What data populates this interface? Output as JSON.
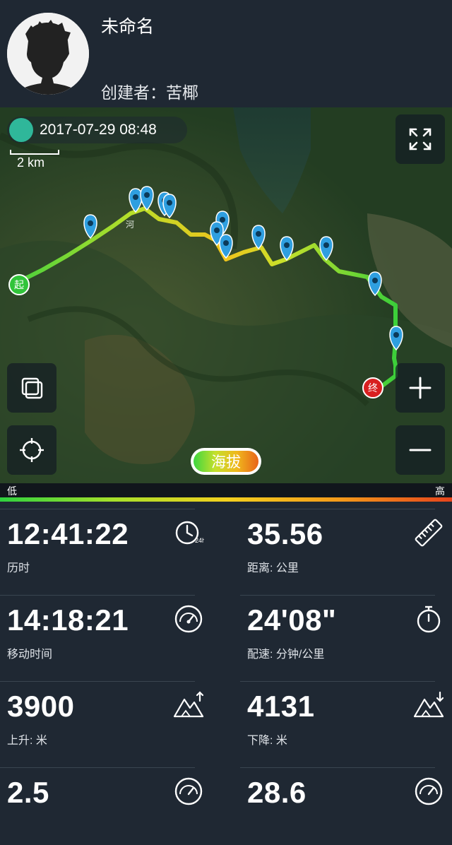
{
  "header": {
    "title": "未命名",
    "creator": "创建者：苦椰"
  },
  "map": {
    "date": "2017-07-29 08:48",
    "scale_label": "2 km",
    "start_marker": "起",
    "end_marker": "终",
    "place_label": "河",
    "legend_label": "海拔",
    "gradient_low": "低",
    "gradient_high": "高",
    "buttons": [
      "fullscreen-icon",
      "layers-icon",
      "locate-icon",
      "zoom-in-icon",
      "zoom-out-icon"
    ]
  },
  "stats": [
    {
      "value": "12:41:22",
      "label": "历时",
      "icon": "clock-24h-icon"
    },
    {
      "value": "35.56",
      "label": "距离: 公里",
      "icon": "ruler-icon"
    },
    {
      "value": "14:18:21",
      "label": "移动时间",
      "icon": "speedometer-icon"
    },
    {
      "value": "24'08\"",
      "label": "配速: 分钟/公里",
      "icon": "stopwatch-icon"
    },
    {
      "value": "3900",
      "label": "上升: 米",
      "icon": "mountain-up-icon"
    },
    {
      "value": "4131",
      "label": "下降: 米",
      "icon": "mountain-down-icon"
    },
    {
      "value": "2.5",
      "label": "",
      "icon": "speedometer-icon"
    },
    {
      "value": "28.6",
      "label": "",
      "icon": "speedometer-icon"
    }
  ]
}
